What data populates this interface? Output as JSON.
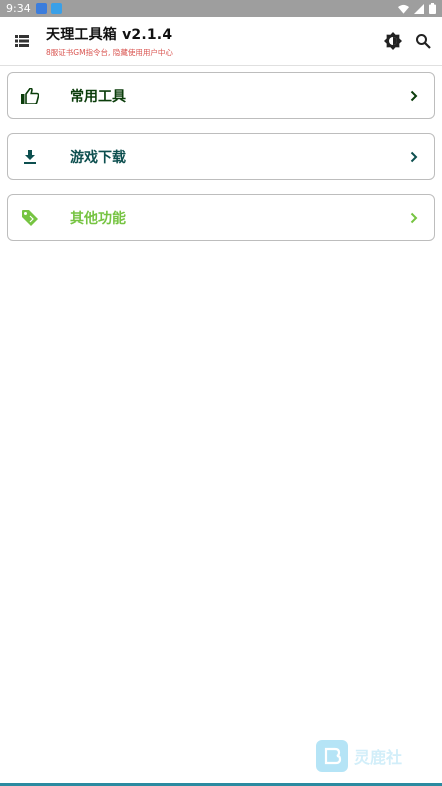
{
  "status_bar": {
    "time": "9:34"
  },
  "app_bar": {
    "title": "天理工具箱 v2.1.4",
    "subtitle": "8服证书GM指令台, 隐藏使用用户中心"
  },
  "items": [
    {
      "label": "常用工具",
      "icon": "thumb-up-icon",
      "color": "#0b3d0b"
    },
    {
      "label": "游戏下载",
      "icon": "download-icon",
      "color": "#0d4f4f"
    },
    {
      "label": "其他功能",
      "icon": "tag-icon",
      "color": "#76c442"
    }
  ],
  "watermark": {
    "text": "灵鹿社"
  },
  "colors": {
    "subtitle": "#d9534f",
    "status_bar": "#9e9e9e"
  }
}
